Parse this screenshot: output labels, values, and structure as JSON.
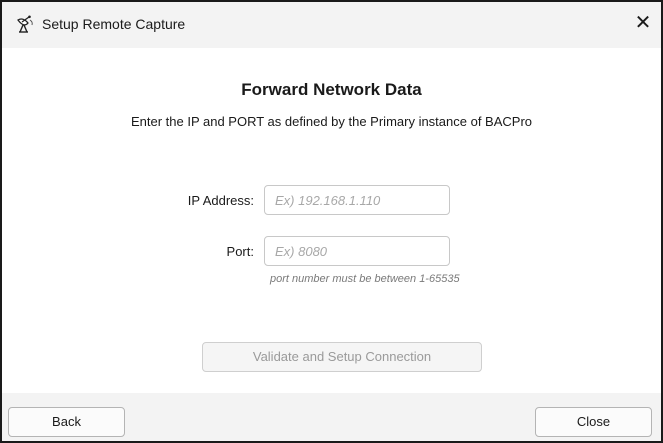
{
  "window": {
    "title": "Setup Remote Capture",
    "close_glyph": "✕",
    "app_icon": "satellite-dish-icon"
  },
  "content": {
    "heading": "Forward Network Data",
    "instructions": "Enter the IP and PORT as defined by the Primary instance of BACPro",
    "ip_field": {
      "label": "IP Address:",
      "value": "",
      "placeholder": "Ex) 192.168.1.110"
    },
    "port_field": {
      "label": "Port:",
      "value": "",
      "placeholder": "Ex) 8080",
      "hint": "port number must be between 1-65535"
    },
    "validate_button": {
      "label": "Validate and Setup Connection",
      "enabled": false
    }
  },
  "footer": {
    "back_label": "Back",
    "close_label": "Close"
  },
  "colors": {
    "chrome_bg": "#f3f3f3",
    "content_bg": "#ffffff",
    "text": "#1a1a1a",
    "placeholder": "#a8a8a8",
    "disabled_text": "#9a9a9a"
  }
}
